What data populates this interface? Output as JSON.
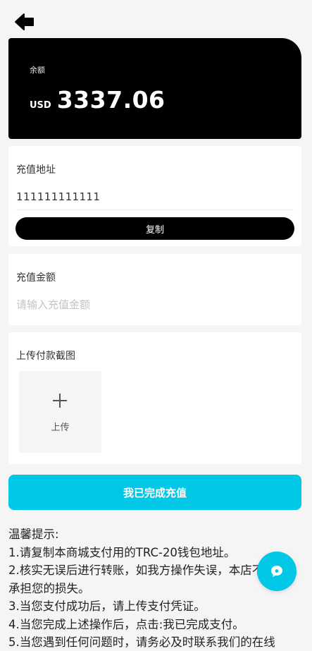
{
  "header": {
    "back_icon": "arrow-left-icon"
  },
  "balance": {
    "label": "余额",
    "currency": "USD",
    "amount": "3337.06"
  },
  "deposit_address": {
    "title": "充值地址",
    "value": "111111111111",
    "copy_label": "复制"
  },
  "deposit_amount": {
    "title": "充值金额",
    "placeholder": "请输入充值金额",
    "value": ""
  },
  "upload": {
    "title": "上传付款截图",
    "button_label": "上传",
    "icon": "plus-icon"
  },
  "submit": {
    "label": "我已完成充值"
  },
  "tips": {
    "lines": [
      "温馨提示:",
      "1.请复制本商城支付用的TRC-20钱包地址。",
      "2.核实无误后进行转账，如我方操作失误，本店不",
      "承担您的损失。",
      "3.当您支付成功后，请上传支付凭证。",
      "4.当您完成上述操作后，点击:我已完成支付。",
      "5.当您遇到任何问题时，请务必及时联系我们的在线"
    ]
  },
  "chat": {
    "icon": "chat-icon"
  },
  "colors": {
    "accent": "#00c8e6",
    "card": "#000000",
    "background": "#f5f5f6"
  }
}
